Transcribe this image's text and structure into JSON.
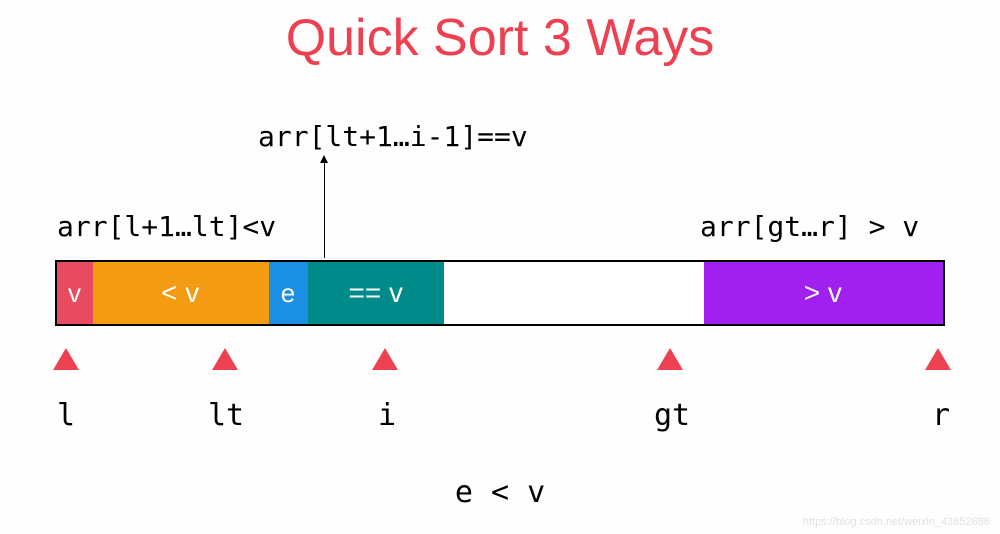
{
  "title": "Quick Sort 3 Ways",
  "annotations": {
    "lt_range": "arr[l+1…lt]<v",
    "eq_range": "arr[lt+1…i-1]==v",
    "gt_range": "arr[gt…r] > v"
  },
  "segments": {
    "pivot": "v",
    "less": "< v",
    "current": "e",
    "equal": "== v",
    "greater": "> v"
  },
  "pointers": {
    "l": "l",
    "lt": "lt",
    "i": "i",
    "gt": "gt",
    "r": "r"
  },
  "condition": "e < v",
  "watermark": "https://blog.csdn.net/weixin_43852686",
  "colors": {
    "title": "#ed4152",
    "pivot": "#e84a5f",
    "less": "#f39c12",
    "current": "#1a8fe3",
    "equal": "#008b8b",
    "greater": "#a020f0",
    "triangle": "#ed4152"
  }
}
